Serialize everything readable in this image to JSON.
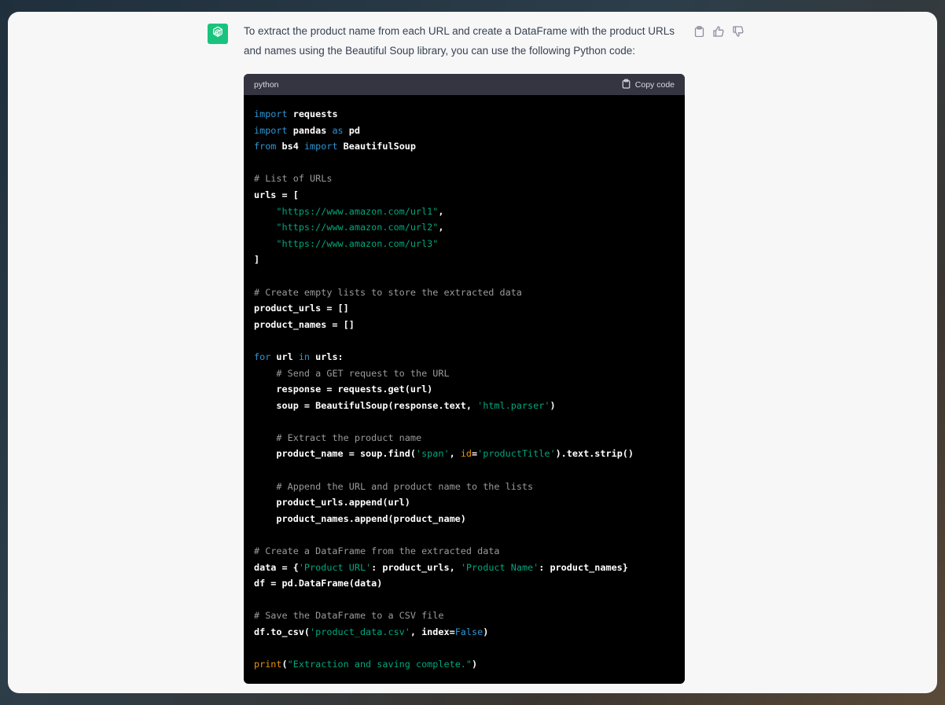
{
  "message": {
    "text": "To extract the product name from each URL and create a DataFrame with the product URLs and names using the Beautiful Soup library, you can use the following Python code:"
  },
  "actions": {
    "icons": [
      "clipboard-icon",
      "thumbs-up-icon",
      "thumbs-down-icon"
    ]
  },
  "code_block": {
    "language": "python",
    "copy_label": "Copy code",
    "lines": [
      [
        [
          "kw",
          "import"
        ],
        [
          "t",
          " requests"
        ]
      ],
      [
        [
          "kw",
          "import"
        ],
        [
          "t",
          " pandas "
        ],
        [
          "kw",
          "as"
        ],
        [
          "t",
          " pd"
        ]
      ],
      [
        [
          "kw",
          "from"
        ],
        [
          "t",
          " bs4 "
        ],
        [
          "kw",
          "import"
        ],
        [
          "t",
          " BeautifulSoup"
        ]
      ],
      [],
      [
        [
          "cm",
          "# List of URLs"
        ]
      ],
      [
        [
          "t",
          "urls = ["
        ]
      ],
      [
        [
          "t",
          "    "
        ],
        [
          "st",
          "\"https://www.amazon.com/url1\""
        ],
        [
          "t",
          ","
        ]
      ],
      [
        [
          "t",
          "    "
        ],
        [
          "st",
          "\"https://www.amazon.com/url2\""
        ],
        [
          "t",
          ","
        ]
      ],
      [
        [
          "t",
          "    "
        ],
        [
          "st",
          "\"https://www.amazon.com/url3\""
        ]
      ],
      [
        [
          "t",
          "]"
        ]
      ],
      [],
      [
        [
          "cm",
          "# Create empty lists to store the extracted data"
        ]
      ],
      [
        [
          "t",
          "product_urls = []"
        ]
      ],
      [
        [
          "t",
          "product_names = []"
        ]
      ],
      [],
      [
        [
          "kw",
          "for"
        ],
        [
          "t",
          " url "
        ],
        [
          "kw",
          "in"
        ],
        [
          "t",
          " urls:"
        ]
      ],
      [
        [
          "t",
          "    "
        ],
        [
          "cm",
          "# Send a GET request to the URL"
        ]
      ],
      [
        [
          "t",
          "    response = requests.get(url)"
        ]
      ],
      [
        [
          "t",
          "    soup = BeautifulSoup(response.text, "
        ],
        [
          "st",
          "'html.parser'"
        ],
        [
          "t",
          ")"
        ]
      ],
      [],
      [
        [
          "t",
          "    "
        ],
        [
          "cm",
          "# Extract the product name"
        ]
      ],
      [
        [
          "t",
          "    product_name = soup.find("
        ],
        [
          "st",
          "'span'"
        ],
        [
          "t",
          ", "
        ],
        [
          "bi",
          "id"
        ],
        [
          "t",
          "="
        ],
        [
          "st",
          "'productTitle'"
        ],
        [
          "t",
          ").text.strip()"
        ]
      ],
      [],
      [
        [
          "t",
          "    "
        ],
        [
          "cm",
          "# Append the URL and product name to the lists"
        ]
      ],
      [
        [
          "t",
          "    product_urls.append(url)"
        ]
      ],
      [
        [
          "t",
          "    product_names.append(product_name)"
        ]
      ],
      [],
      [
        [
          "cm",
          "# Create a DataFrame from the extracted data"
        ]
      ],
      [
        [
          "t",
          "data = {"
        ],
        [
          "st",
          "'Product URL'"
        ],
        [
          "t",
          ": product_urls, "
        ],
        [
          "st",
          "'Product Name'"
        ],
        [
          "t",
          ": product_names}"
        ]
      ],
      [
        [
          "t",
          "df = pd.DataFrame(data)"
        ]
      ],
      [],
      [
        [
          "cm",
          "# Save the DataFrame to a CSV file"
        ]
      ],
      [
        [
          "t",
          "df.to_csv("
        ],
        [
          "st",
          "'product_data.csv'"
        ],
        [
          "t",
          ", index="
        ],
        [
          "kw",
          "False"
        ],
        [
          "t",
          ")"
        ]
      ],
      [],
      [
        [
          "bi",
          "print"
        ],
        [
          "t",
          "("
        ],
        [
          "st",
          "\"Extraction and saving complete.\""
        ],
        [
          "t",
          ")"
        ]
      ]
    ]
  }
}
